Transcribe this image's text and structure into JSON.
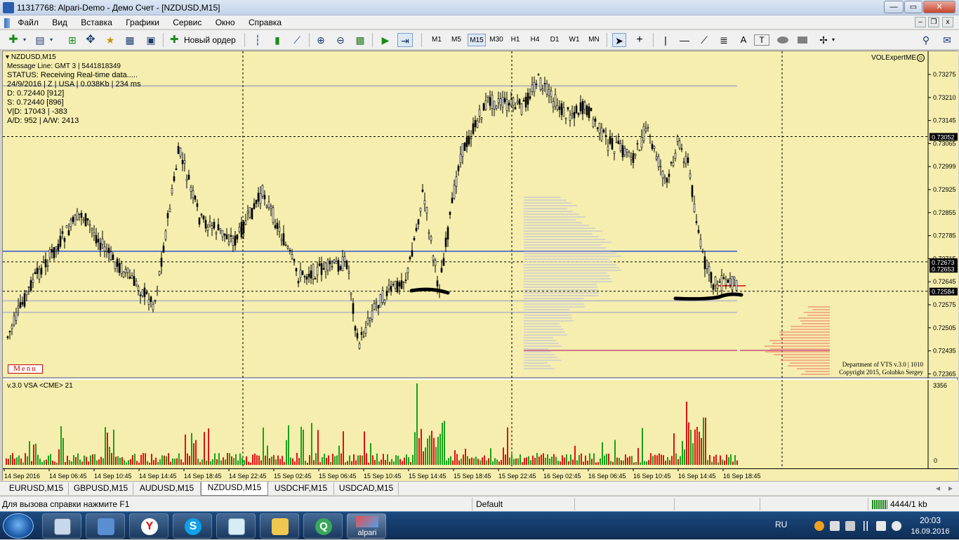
{
  "window": {
    "title": "11317768: Alpari-Demo - Демо Счет - [NZDUSD,M15]",
    "buttons": {
      "minimize": "—",
      "restore": "▭",
      "close": "✕"
    }
  },
  "menu": {
    "items": [
      "Файл",
      "Вид",
      "Вставка",
      "Графики",
      "Сервис",
      "Окно",
      "Справка"
    ],
    "mdi": {
      "minimize": "–",
      "restore": "❐",
      "close": "x"
    }
  },
  "toolbar": {
    "new_order": "Новый ордер",
    "timeframes": [
      "M1",
      "M5",
      "M15",
      "M30",
      "H1",
      "H4",
      "D1",
      "W1",
      "MN"
    ],
    "active_timeframe": "M15",
    "text_tool": "A",
    "label_tool": "T"
  },
  "chart": {
    "symbol": "NZDUSD,M15",
    "info_lines": [
      "Message Line: GMT 3 | 5441818349",
      "STATUS:  Receiving Real-time data.....",
      "24/9/2016 | Z | USA | 0.038Kb | 234 ms",
      "D: 0.72440  [912]",
      "S: 0.72440  [896]",
      "V|D: 17043 | -383",
      "A/D: 952 | A/W: 2413"
    ],
    "expert": "VOLExpertME",
    "expert_icon": "☺",
    "menu_button": "Menu",
    "copyright": [
      "Department of VTS  v.3.0 | 1010",
      "Copyright 2015, Golubko Sergey"
    ],
    "price_labels": [
      "0.73275",
      "0.73210",
      "0.73145",
      "0.73065",
      "0.72999",
      "0.72925",
      "0.72855",
      "0.72785",
      "0.72715",
      "0.72645",
      "0.72575",
      "0.72505",
      "0.72435",
      "0.72365"
    ],
    "highlight_prices": {
      "top": "0.73052",
      "mid1": "0.72673",
      "mid2": "0.72653",
      "low": "0.72584"
    },
    "time_labels": [
      "14 Sep 2016",
      "14 Sep 06:45",
      "14 Sep 10:45",
      "14 Sep 14:45",
      "14 Sep 18:45",
      "14 Sep 22:45",
      "15 Sep 02:45",
      "15 Sep 06:45",
      "15 Sep 10:45",
      "15 Sep 14:45",
      "15 Sep 18:45",
      "15 Sep 22:45",
      "16 Sep 02:45",
      "16 Sep 06:45",
      "16 Sep 10:45",
      "16 Sep 14:45",
      "16 Sep 18:45"
    ],
    "colors": {
      "background": "#f5eeae",
      "up_volume": "#19a019",
      "down_volume": "#e01010",
      "level_line": "#3355cc",
      "profile": "#b8b8e0",
      "profile_right": "#f07060"
    }
  },
  "indicator": {
    "label": "v.3.0 VSA <CME> 21",
    "max": "3356",
    "zero": "0"
  },
  "tabs": [
    "EURUSD,M15",
    "GBPUSD,M15",
    "AUDUSD,M15",
    "NZDUSD,M15",
    "USDCHF,M15",
    "USDCAD,M15"
  ],
  "active_tab": "NZDUSD,M15",
  "tab_nav": {
    "prev": "◂",
    "next": "▸"
  },
  "status": {
    "help": "Для вызова справки нажмите F1",
    "profile": "Default",
    "traffic": "4444/1 kb"
  },
  "taskbar": {
    "apps": [
      "calculator",
      "network",
      "yandex",
      "skype",
      "notepad",
      "explorer",
      "qip",
      "alpari"
    ],
    "alpari_label": "alpari",
    "lang": "RU",
    "time": "20:03",
    "date": "16.09.2016"
  }
}
